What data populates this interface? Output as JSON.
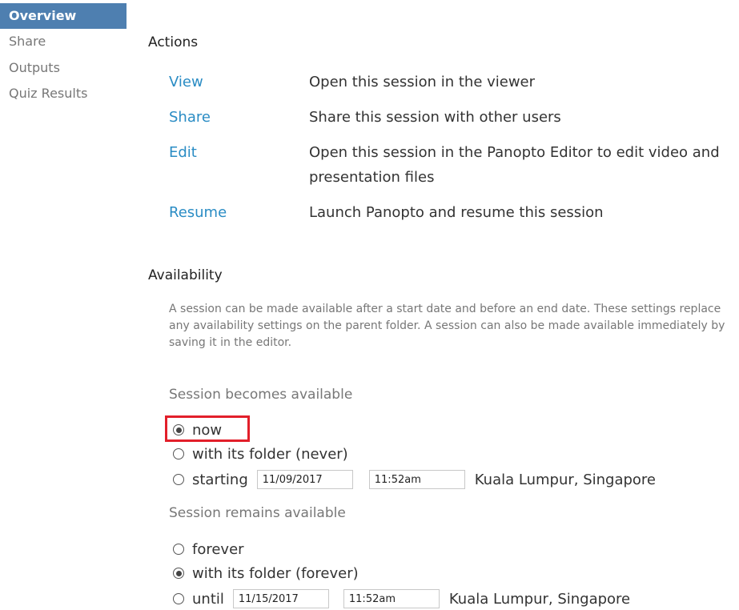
{
  "sidebar": {
    "items": [
      {
        "label": "Overview"
      },
      {
        "label": "Share"
      },
      {
        "label": "Outputs"
      },
      {
        "label": "Quiz Results"
      }
    ]
  },
  "actions": {
    "title": "Actions",
    "items": [
      {
        "link": "View",
        "desc": "Open this session in the viewer"
      },
      {
        "link": "Share",
        "desc": "Share this session with other users"
      },
      {
        "link": "Edit",
        "desc": "Open this session in the Panopto Editor to edit video and presentation files"
      },
      {
        "link": "Resume",
        "desc": "Launch Panopto and resume this session"
      }
    ]
  },
  "availability": {
    "title": "Availability",
    "help": "A session can be made available after a start date and before an end date. These settings replace any availability settings on the parent folder. A session can also be made available immediately by saving it in the editor.",
    "becomes": {
      "label": "Session becomes available",
      "now": "now",
      "with_folder": "with its folder (never)",
      "starting": "starting",
      "start_date": "11/09/2017",
      "start_time": "11:52am",
      "timezone": "Kuala Lumpur, Singapore"
    },
    "remains": {
      "label": "Session remains available",
      "forever": "forever",
      "with_folder": "with its folder (forever)",
      "until": "until",
      "end_date": "11/15/2017",
      "end_time": "11:52am",
      "timezone": "Kuala Lumpur, Singapore"
    }
  },
  "colors": {
    "accent": "#4e7fb0",
    "link": "#2a8cc4",
    "highlight": "#e21f2a"
  }
}
